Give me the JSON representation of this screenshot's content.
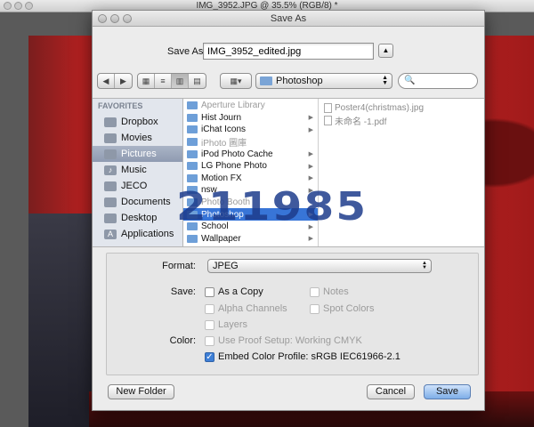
{
  "background_window": {
    "title": "IMG_3952.JPG @ 35.5% (RGB/8) *"
  },
  "dialog": {
    "title": "Save As",
    "save_as_label": "Save As:",
    "filename": "IMG_3952_edited.jpg",
    "expand_icon": "triangle-up-icon"
  },
  "toolbar": {
    "back_icon": "◀",
    "forward_icon": "▶",
    "view_icons": [
      "▦",
      "≡",
      "▥",
      "▤"
    ],
    "arrange_icon": "▦▾",
    "current_folder": "Photoshop",
    "search_icon": "🔍"
  },
  "sidebar": {
    "heading": "FAVORITES",
    "items": [
      {
        "label": "Dropbox",
        "icon": "folder-icon",
        "selected": false
      },
      {
        "label": "Movies",
        "icon": "movies-icon",
        "selected": false
      },
      {
        "label": "Pictures",
        "icon": "pictures-icon",
        "selected": true
      },
      {
        "label": "Music",
        "icon": "music-icon",
        "selected": false
      },
      {
        "label": "JECO",
        "icon": "folder-icon",
        "selected": false
      },
      {
        "label": "Documents",
        "icon": "documents-icon",
        "selected": false
      },
      {
        "label": "Desktop",
        "icon": "desktop-icon",
        "selected": false
      },
      {
        "label": "Applications",
        "icon": "applications-icon",
        "selected": false
      }
    ]
  },
  "column1": {
    "items": [
      {
        "label": "Aperture Library",
        "dim": true,
        "has_children": false
      },
      {
        "label": "Hist Journ",
        "dim": false,
        "has_children": true
      },
      {
        "label": "iChat Icons",
        "dim": false,
        "has_children": true
      },
      {
        "label": "iPhoto 圖庫",
        "dim": true,
        "has_children": false
      },
      {
        "label": "iPod Photo Cache",
        "dim": false,
        "has_children": true
      },
      {
        "label": "LG Phone Photo",
        "dim": false,
        "has_children": true
      },
      {
        "label": "Motion FX",
        "dim": false,
        "has_children": true
      },
      {
        "label": "nsw",
        "dim": false,
        "has_children": true
      },
      {
        "label": "Photo Booth",
        "dim": true,
        "has_children": false
      },
      {
        "label": "Photoshop",
        "dim": false,
        "has_children": true,
        "selected": true
      },
      {
        "label": "School",
        "dim": false,
        "has_children": true
      },
      {
        "label": "Wallpaper",
        "dim": false,
        "has_children": true
      }
    ]
  },
  "column2": {
    "items": [
      {
        "label": "Poster4(christmas).jpg"
      },
      {
        "label": "未命名 -1.pdf"
      }
    ]
  },
  "watermark": "211985",
  "options": {
    "format_label": "Format:",
    "format_value": "JPEG",
    "save_label": "Save:",
    "as_a_copy": "As a Copy",
    "notes": "Notes",
    "alpha_channels": "Alpha Channels",
    "spot_colors": "Spot Colors",
    "layers": "Layers",
    "color_label": "Color:",
    "use_proof_setup": "Use Proof Setup:  Working CMYK",
    "embed_color_profile": "Embed Color Profile:  sRGB IEC61966-2.1"
  },
  "buttons": {
    "new_folder": "New Folder",
    "cancel": "Cancel",
    "save": "Save"
  }
}
